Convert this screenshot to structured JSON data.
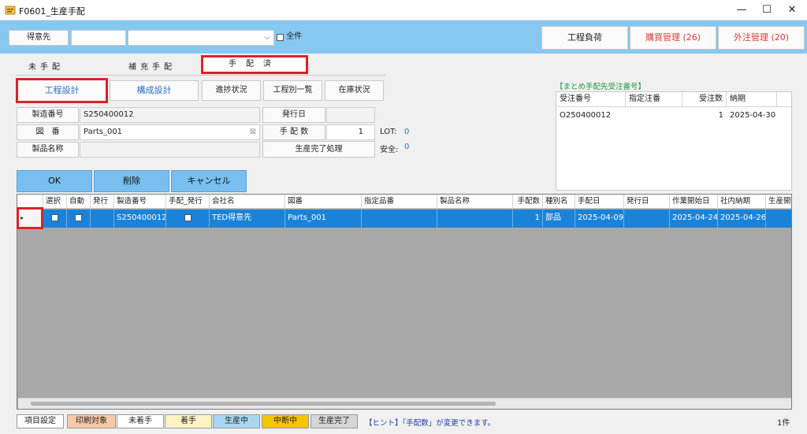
{
  "window": {
    "title": "F0601_生産手配",
    "minimize": "—",
    "maximize": "☐",
    "close": "✕"
  },
  "topbar": {
    "customer_label": "得意先",
    "customer_code": "",
    "customer_name": "",
    "all_label": "全件",
    "btn_process_load": "工程負荷",
    "btn_purchase_mgmt": "購買管理 (26)",
    "btn_outsourcing_mgmt": "外注管理 (20)"
  },
  "tabs": {
    "unarranged": "未手配",
    "supplemental": "補充手配",
    "arranged": "手配済"
  },
  "buttons": {
    "process_design": "工程設計",
    "composition_design": "構成設計",
    "progress_status": "進捗状況",
    "process_list": "工程別一覧",
    "stock_status": "在庫状況",
    "production_complete": "生産完了処理",
    "ok": "OK",
    "delete": "削除",
    "cancel": "キャンセル"
  },
  "form": {
    "manufacturing_no_label": "製造番号",
    "manufacturing_no": "S250400012",
    "drawing_label": "図　番",
    "drawing": "Parts_001",
    "product_name_label": "製品名称",
    "product_name": "",
    "issue_date_label": "発行日",
    "issue_date": "",
    "arrange_qty_label": "手 配 数",
    "arrange_qty": "1",
    "lot_label": "LOT:",
    "lot_value": "0",
    "safety_label": "安全:",
    "safety_value": "0"
  },
  "order_panel": {
    "title": "【まとめ手配先受注番号】",
    "columns": [
      "受注番号",
      "指定注番",
      "受注数",
      "納期"
    ],
    "rows": [
      {
        "order_no": "O250400012",
        "designated": "",
        "qty": "1",
        "due": "2025-04-30"
      }
    ]
  },
  "grid": {
    "columns": [
      "",
      "選択",
      "自動",
      "発行",
      "製造番号",
      "手配_発行",
      "会社名",
      "図番",
      "指定品番",
      "製品名称",
      "手配数",
      "種別名",
      "手配日",
      "発行日",
      "作業開始日",
      "社内納期",
      "生産開"
    ],
    "rows": [
      {
        "selected": false,
        "auto": false,
        "issued": "",
        "manufacturing_no": "S250400012",
        "arrange_issue": false,
        "company": "TED得意先",
        "drawing": "Parts_001",
        "designated_part": "",
        "product_name": "",
        "qty": "1",
        "type": "部品",
        "arrange_date": "2025-04-09",
        "issue_date": "",
        "work_start": "2025-04-24",
        "internal_due": "2025-04-26",
        "prod_start": ""
      }
    ]
  },
  "status_bar": {
    "item_settings": "項目設定",
    "legend": [
      {
        "label": "印刷対象",
        "color": "#f6c8a6"
      },
      {
        "label": "未着手",
        "color": "#ffffff"
      },
      {
        "label": "着手",
        "color": "#fdf3c2"
      },
      {
        "label": "生産中",
        "color": "#a9d6f2"
      },
      {
        "label": "中断中",
        "color": "#f7c400"
      },
      {
        "label": "生産完了",
        "color": "#d6d6d6"
      }
    ],
    "hint": "【ヒント】「手配数」が変更できます。",
    "count": "1件"
  },
  "colors": {
    "accent_blue": "#87c8f0",
    "selection_blue": "#1a83d8",
    "button_blue": "#78bfef",
    "highlight_red": "#d8232a",
    "red_text": "#e23a3a",
    "green_title": "#1d9a3d"
  }
}
